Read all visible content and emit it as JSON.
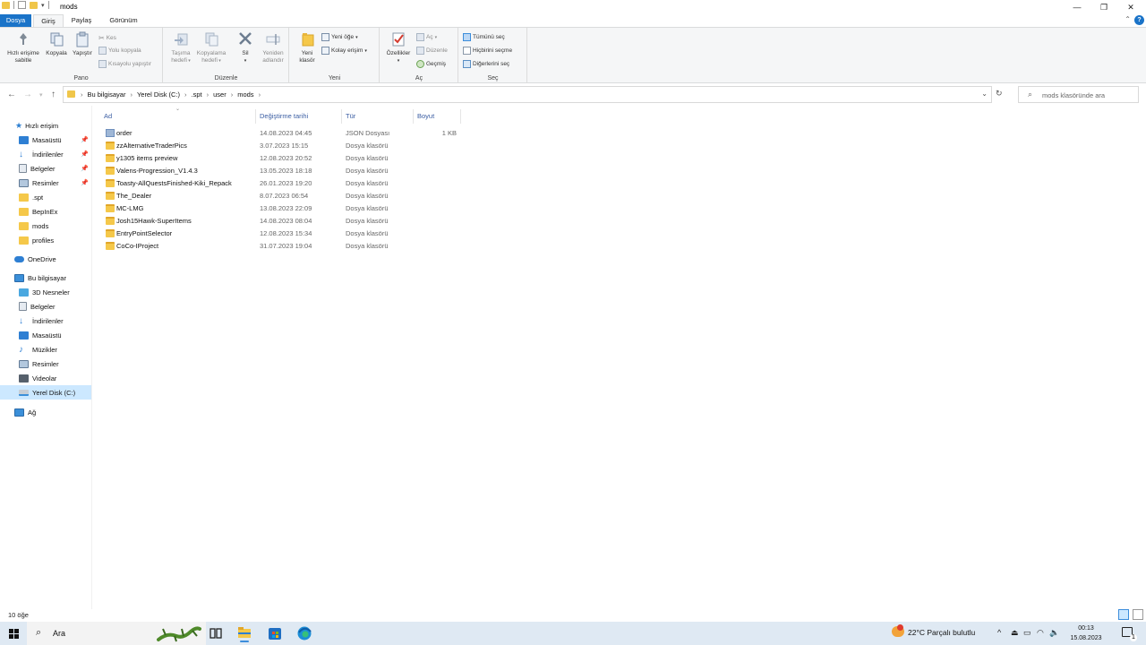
{
  "window": {
    "title": "mods",
    "controls": {
      "minimize": "—",
      "maximize": "❐",
      "close": "✕"
    }
  },
  "ribbon_tabs": [
    "Dosya",
    "Giriş",
    "Paylaş",
    "Görünüm"
  ],
  "ribbon": {
    "pano": {
      "label": "Pano",
      "pin": "Hızlı erişime sabitle",
      "copy": "Kopyala",
      "paste": "Yapıştır",
      "cut": "Kes",
      "copy_path": "Yolu kopyala",
      "paste_shortcut": "Kısayolu yapıştır"
    },
    "duzenle": {
      "label": "Düzenle",
      "move_to": "Taşıma hedefi",
      "copy_to": "Kopyalama hedefi",
      "delete": "Sil",
      "rename": "Yeniden adlandır"
    },
    "yeni": {
      "label": "Yeni",
      "new_folder": "Yeni klasör",
      "new_item": "Yeni öğe",
      "easy_access": "Kolay erişim"
    },
    "ac": {
      "label": "Aç",
      "properties": "Özellikler",
      "open": "Aç",
      "edit": "Düzenle",
      "history": "Geçmiş"
    },
    "sec": {
      "label": "Seç",
      "select_all": "Tümünü seç",
      "select_none": "Hiçbirini seçme",
      "invert": "Diğerlerini seç"
    }
  },
  "address": {
    "crumbs": [
      "Bu bilgisayar",
      "Yerel Disk (C:)",
      ".spt",
      "user",
      "mods"
    ],
    "search_placeholder": "mods klasöründe ara"
  },
  "nav_pane": {
    "quick_access": "Hızlı erişim",
    "quick_items": [
      {
        "label": "Masaüstü",
        "pinned": true
      },
      {
        "label": "İndirilenler",
        "pinned": true
      },
      {
        "label": "Belgeler",
        "pinned": true
      },
      {
        "label": "Resimler",
        "pinned": true
      },
      {
        "label": ".spt",
        "pinned": false
      },
      {
        "label": "BepInEx",
        "pinned": false
      },
      {
        "label": "mods",
        "pinned": false
      },
      {
        "label": "profiles",
        "pinned": false
      }
    ],
    "onedrive": "OneDrive",
    "this_pc": "Bu bilgisayar",
    "pc_items": [
      "3D Nesneler",
      "Belgeler",
      "İndirilenler",
      "Masaüstü",
      "Müzikler",
      "Resimler",
      "Videolar",
      "Yerel Disk (C:)"
    ],
    "network": "Ağ"
  },
  "columns": {
    "name": "Ad",
    "modified": "Değiştirme tarihi",
    "type": "Tür",
    "size": "Boyut"
  },
  "files": [
    {
      "name": "order",
      "modified": "14.08.2023 04:45",
      "type": "JSON Dosyası",
      "size": "1 KB",
      "kind": "json"
    },
    {
      "name": "zzAlternativeTraderPics",
      "modified": "3.07.2023 15:15",
      "type": "Dosya klasörü",
      "size": "",
      "kind": "folder"
    },
    {
      "name": "y1305 items preview",
      "modified": "12.08.2023 20:52",
      "type": "Dosya klasörü",
      "size": "",
      "kind": "folder"
    },
    {
      "name": "Valens-Progression_V1.4.3",
      "modified": "13.05.2023 18:18",
      "type": "Dosya klasörü",
      "size": "",
      "kind": "folder"
    },
    {
      "name": "Toasty-AllQuestsFinished-Kiki_Repack",
      "modified": "26.01.2023 19:20",
      "type": "Dosya klasörü",
      "size": "",
      "kind": "folder"
    },
    {
      "name": "The_Dealer",
      "modified": "8.07.2023 06:54",
      "type": "Dosya klasörü",
      "size": "",
      "kind": "folder"
    },
    {
      "name": "MC-LMG",
      "modified": "13.08.2023 22:09",
      "type": "Dosya klasörü",
      "size": "",
      "kind": "folder"
    },
    {
      "name": "Josh15Hawk-SuperItems",
      "modified": "14.08.2023 08:04",
      "type": "Dosya klasörü",
      "size": "",
      "kind": "folder"
    },
    {
      "name": "EntryPointSelector",
      "modified": "12.08.2023 15:34",
      "type": "Dosya klasörü",
      "size": "",
      "kind": "folder"
    },
    {
      "name": "CoCo-IProject",
      "modified": "31.07.2023 19:04",
      "type": "Dosya klasörü",
      "size": "",
      "kind": "folder"
    }
  ],
  "status": {
    "count": "10 öğe"
  },
  "taskbar": {
    "search_label": "Ara",
    "weather": "22°C  Parçalı bulutlu",
    "time": "00:13",
    "date": "15.08.2023",
    "notification_badge": "1"
  }
}
